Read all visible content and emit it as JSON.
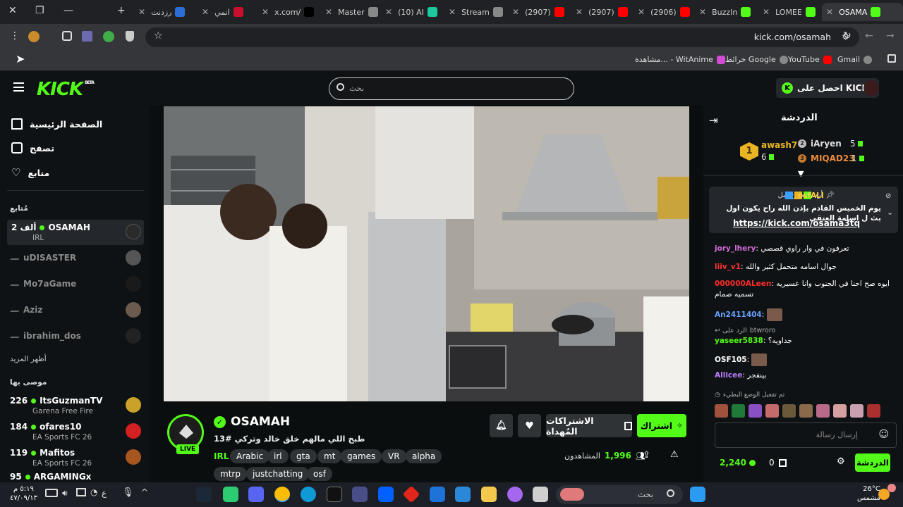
{
  "browser": {
    "tabs": [
      {
        "label": "رزدنت",
        "color": "#2b6fd6"
      },
      {
        "label": "انمي",
        "color": "#c8102e"
      },
      {
        "label": "x.com/",
        "color": "#000000"
      },
      {
        "label": "Master",
        "color": "#888888"
      },
      {
        "label": "(10) AI",
        "color": "#1ec9a0"
      },
      {
        "label": "Stream",
        "color": "#888888"
      },
      {
        "label": "(2907)",
        "color": "#ff0000"
      },
      {
        "label": "(2907)",
        "color": "#ff0000"
      },
      {
        "label": "(2906)",
        "color": "#ff0000"
      },
      {
        "label": "BuzzIn",
        "color": "#53fc18"
      },
      {
        "label": "LOMEE",
        "color": "#53fc18"
      },
      {
        "label": "OSAMA",
        "color": "#53fc18"
      }
    ],
    "url": "kick.com/osamah",
    "bookmarks": [
      "Gmail",
      "YouTube",
      "خرائط Google",
      "مشاهدة... - WitAnime"
    ]
  },
  "kick": {
    "logo": "KICK",
    "logo_beta": "BETA",
    "search_placeholder": "بحث",
    "get_kicks": "احصل على KICKs",
    "accent": "#53fc18"
  },
  "sidebar": {
    "nav": [
      {
        "label": "الصفحة الرئيسية",
        "icon": "home-icon"
      },
      {
        "label": "تصفح",
        "icon": "browse-icon"
      },
      {
        "label": "متابع",
        "icon": "heart-icon"
      }
    ],
    "following_title": "مُتابع",
    "following": [
      {
        "name": "OSAMAH",
        "viewers": "2 ألف",
        "sub": "IRL",
        "live": true
      },
      {
        "name": "uDISASTER",
        "live": false
      },
      {
        "name": "Mo7aGame",
        "live": false
      },
      {
        "name": "Aziz",
        "live": false
      },
      {
        "name": "ibrahim_dos",
        "live": false
      }
    ],
    "show_more": "أظهر المزيد",
    "recommended_title": "موصى بها",
    "recommended": [
      {
        "count": "226",
        "name": "ItsGuzmanTV",
        "game": "Garena Free Fire"
      },
      {
        "count": "184",
        "name": "ofares10",
        "game": "EA Sports FC 26"
      },
      {
        "count": "119",
        "name": "Mafitos",
        "game": "EA Sports FC 26"
      },
      {
        "count": "95",
        "name": "ARGAMINGx",
        "game": ""
      }
    ]
  },
  "stream": {
    "name": "OSAMAH",
    "title": "طبخ اللي مالهم خلق خالد وتركي #13",
    "live_label": "LIVE",
    "tags": [
      "IRL",
      "Arabic",
      "irl",
      "gta",
      "mt",
      "games",
      "VR",
      "alpha",
      "mtrp",
      "justchatting",
      "osf"
    ],
    "subscribe": "اشتراك",
    "gift_subs": "الاشتراكات المُهداة",
    "viewers_label": "المشاهدون",
    "viewers": "1,996"
  },
  "chat": {
    "title": "الدردشة",
    "leaders": [
      {
        "rank": "1",
        "name": "awash7",
        "count": "6"
      },
      {
        "rank": "2",
        "name": "iAryen",
        "count": "5"
      },
      {
        "rank": "3",
        "name": "MIQAD23",
        "count": "1"
      }
    ],
    "pinned": {
      "by_label": "أرسلت من قبل",
      "by_user": "osfALI",
      "text": "يوم الخميس القادم بإذن الله راح يكون اول بث ل اسامة العتقي",
      "link": "https://kick.com/osama3tq"
    },
    "messages": [
      {
        "user": "jory_lhery",
        "color": "#d36bd8",
        "text": "تعرفون في وار راوي قصصي"
      },
      {
        "user": "liiv_v1",
        "color": "#ff3333",
        "text": "جوال اسامه متحمل كثير والله"
      },
      {
        "user": "000000ALeen",
        "color": "#ff2b2b",
        "text": "ايوه صح احنا في الجنوب وانا عسيريه تسميه صمام"
      },
      {
        "user": "An2411404",
        "color": "#6aa0ff",
        "text": ""
      },
      {
        "user": "yaseer5838",
        "color": "#53fc18",
        "text": "جداويه؟",
        "reply_to": "btwroro",
        "reply_label": "الرد على"
      },
      {
        "user": "OSF105",
        "color": "#ffffff",
        "text": ""
      },
      {
        "user": "Allicee",
        "color": "#b97dff",
        "text": "بينفجر"
      }
    ],
    "slow_mode": "تم تفعيل الوضع البطيء",
    "input_placeholder": "إرسال رسالة",
    "kicks_balance": "2,240",
    "gift_count": "0",
    "chat_button": "الدردشة"
  },
  "taskbar": {
    "search_placeholder": "بحث",
    "time": "٥:١٩ م",
    "date": "٤٧/٠٩/١٣",
    "weather_temp": "26°C",
    "weather_desc": "مشمس",
    "lang": "ع"
  }
}
